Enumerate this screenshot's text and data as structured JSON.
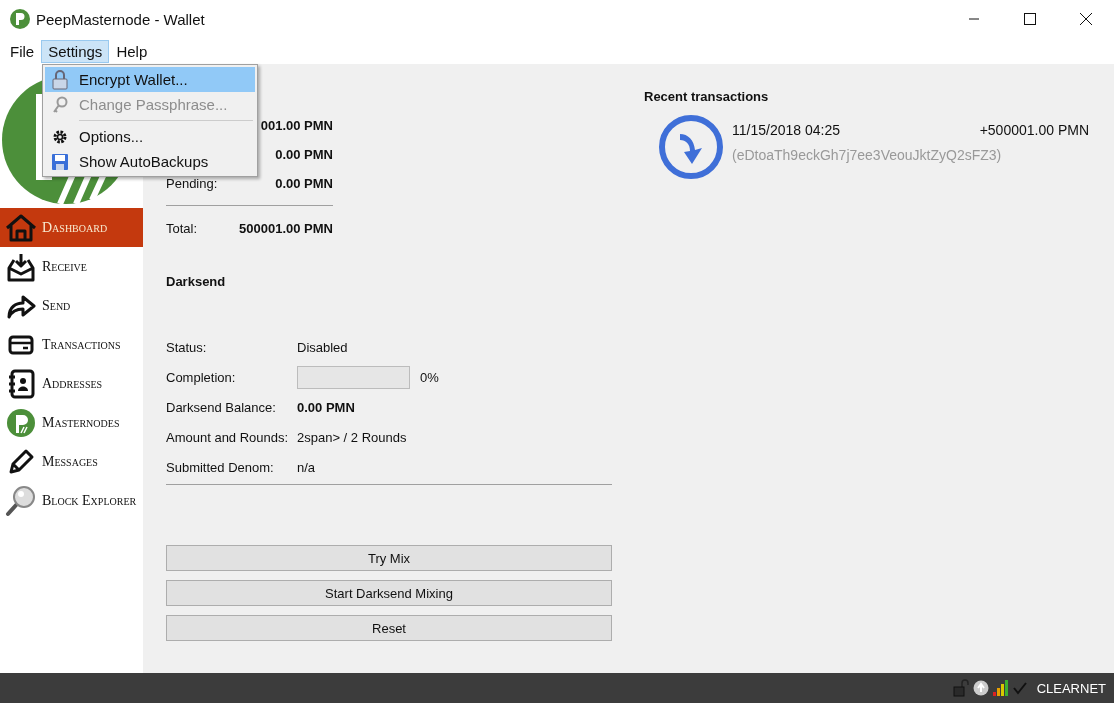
{
  "window": {
    "title": "PeepMasternode - Wallet"
  },
  "menu_bar": [
    {
      "label": "File",
      "selected": false
    },
    {
      "label": "Settings",
      "selected": true
    },
    {
      "label": "Help",
      "selected": false
    }
  ],
  "open_menu": {
    "items": [
      {
        "kind": "item",
        "label": "Encrypt Wallet...",
        "selected": true,
        "disabled": false
      },
      {
        "kind": "item",
        "label": "Change Passphrase...",
        "selected": false,
        "disabled": true
      },
      {
        "kind": "separator"
      },
      {
        "kind": "item",
        "label": "Options...",
        "selected": false,
        "disabled": false
      },
      {
        "kind": "item",
        "label": "Show AutoBackups",
        "selected": false,
        "disabled": false
      }
    ]
  },
  "sidebar": {
    "items": [
      {
        "label": "Dashboard",
        "selected": true
      },
      {
        "label": "Receive",
        "selected": false
      },
      {
        "label": "Send",
        "selected": false
      },
      {
        "label": "Transactions",
        "selected": false
      },
      {
        "label": "Addresses",
        "selected": false
      },
      {
        "label": "Masternodes",
        "selected": false
      },
      {
        "label": "Messages",
        "selected": false
      },
      {
        "label": "Block Explorer",
        "selected": false
      }
    ]
  },
  "balances": {
    "rows": [
      {
        "value": "001.00 PMN"
      },
      {
        "value": "0.00 PMN"
      },
      {
        "label": "Pending:",
        "value": "0.00 PMN"
      }
    ],
    "total": {
      "label": "Total:",
      "value": "500001.00 PMN"
    }
  },
  "darksend": {
    "title": "Darksend",
    "rows": [
      {
        "kind": "text",
        "label": "Status:",
        "value": "Disabled"
      },
      {
        "kind": "progress",
        "label": "Completion:",
        "level": 0,
        "reading": "0%"
      },
      {
        "kind": "bold",
        "label": "Darksend Balance:",
        "value": "0.00 PMN"
      },
      {
        "kind": "text",
        "label": "Amount and Rounds:",
        "value": "2span> / 2 Rounds"
      },
      {
        "kind": "text",
        "label": "Submitted Denom:",
        "value": "n/a"
      }
    ],
    "buttons": [
      "Try Mix",
      "Start Darksend Mixing",
      "Reset"
    ]
  },
  "recent": {
    "title": "Recent transactions",
    "items": [
      {
        "date": "11/15/2018 04:25",
        "amount": "+500001.00 PMN",
        "address": "(eDtoaTh9eckGh7j7ee3VeouJktZyQ2sFZ3)"
      }
    ]
  },
  "status_bar": {
    "network": "CLEARNET"
  }
}
